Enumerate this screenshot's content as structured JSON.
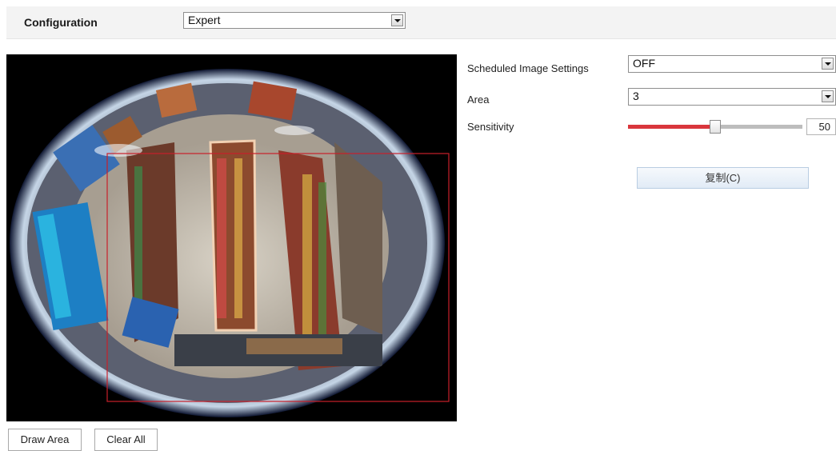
{
  "header": {
    "config_label": "Configuration",
    "mode_select": {
      "value": "Expert"
    }
  },
  "settings": {
    "scheduled_label": "Scheduled Image Settings",
    "scheduled_value": "OFF",
    "area_label": "Area",
    "area_value": "3",
    "sensitivity_label": "Sensitivity",
    "sensitivity_value": "50",
    "sensitivity_fraction": 0.5,
    "copy_button": "复制(C)"
  },
  "video": {
    "region_color": "#c8202a",
    "icons": [
      "fisheye-camera-view"
    ]
  },
  "footer": {
    "draw_area": "Draw Area",
    "clear_all": "Clear All"
  },
  "colors": {
    "slider_active": "#d9363c",
    "slider_track": "#bdbdbd",
    "button_accent": "#e1ebf6"
  }
}
